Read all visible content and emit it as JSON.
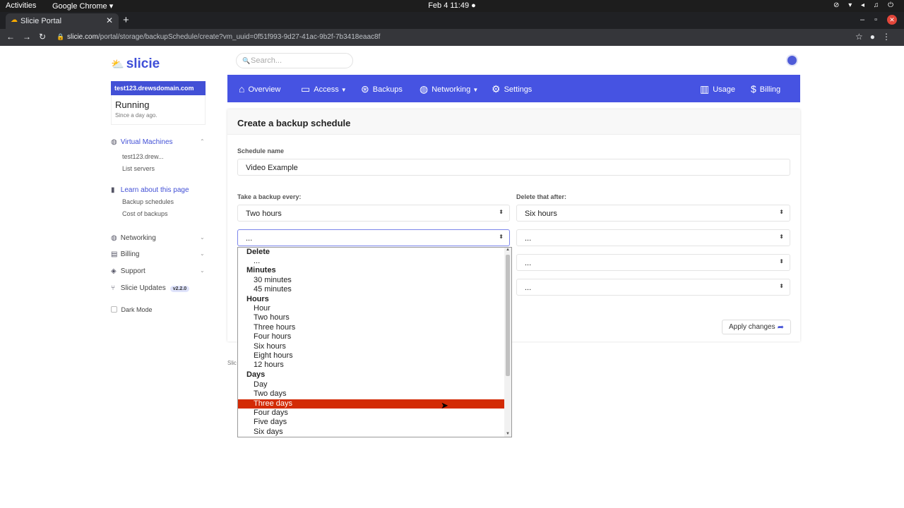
{
  "os": {
    "activities": "Activities",
    "app_name": "Google Chrome ▾",
    "clock": "Feb 4  11:49  ●",
    "tray": "⊘ ▾ ◂ ♫ ⏻"
  },
  "browser": {
    "tab_title": "Slicie Portal",
    "url_host": "slicie.com",
    "url_path": "/portal/storage/backupSchedule/create?vm_uuid=0f51f993-9d27-41ac-9b2f-7b3418eaac8f"
  },
  "brand": {
    "logo": "slicie"
  },
  "search": {
    "placeholder": "Search..."
  },
  "server": {
    "name": "test123.drewsdomain.com",
    "status": "Running",
    "since": "Since a day ago."
  },
  "sidebar": {
    "vm": {
      "label": "Virtual Machines",
      "items": [
        "test123.drew...",
        "List servers"
      ]
    },
    "learn": {
      "label": "Learn about this page",
      "items": [
        "Backup schedules",
        "Cost of backups"
      ]
    },
    "networking": "Networking",
    "billing": "Billing",
    "support": "Support",
    "updates": {
      "label": "Slicie Updates",
      "version": "v2.2.0"
    },
    "dark_mode": "Dark Mode"
  },
  "topnav": {
    "overview": "Overview",
    "access": "Access",
    "backups": "Backups",
    "networking": "Networking",
    "settings": "Settings",
    "usage": "Usage",
    "billing": "Billing"
  },
  "form": {
    "title": "Create a backup schedule",
    "schedule_name_label": "Schedule name",
    "schedule_name_value": "Video Example",
    "every_label": "Take a backup every:",
    "delete_label": "Delete that after:",
    "every_rows": [
      "Two hours",
      "...",
      "",
      ""
    ],
    "delete_rows": [
      "Six hours",
      "...",
      "...",
      "..."
    ],
    "apply_label": "Apply changes"
  },
  "footer": "Slic",
  "dropdown": {
    "groups": [
      {
        "label": "Delete",
        "options": [
          "..."
        ]
      },
      {
        "label": "Minutes",
        "options": [
          "30 minutes",
          "45 minutes"
        ]
      },
      {
        "label": "Hours",
        "options": [
          "Hour",
          "Two hours",
          "Three hours",
          "Four hours",
          "Six hours",
          "Eight hours",
          "12 hours"
        ]
      },
      {
        "label": "Days",
        "options": [
          "Day",
          "Two days",
          "Three days",
          "Four days",
          "Five days",
          "Six days"
        ]
      }
    ],
    "highlighted": "Three days"
  }
}
